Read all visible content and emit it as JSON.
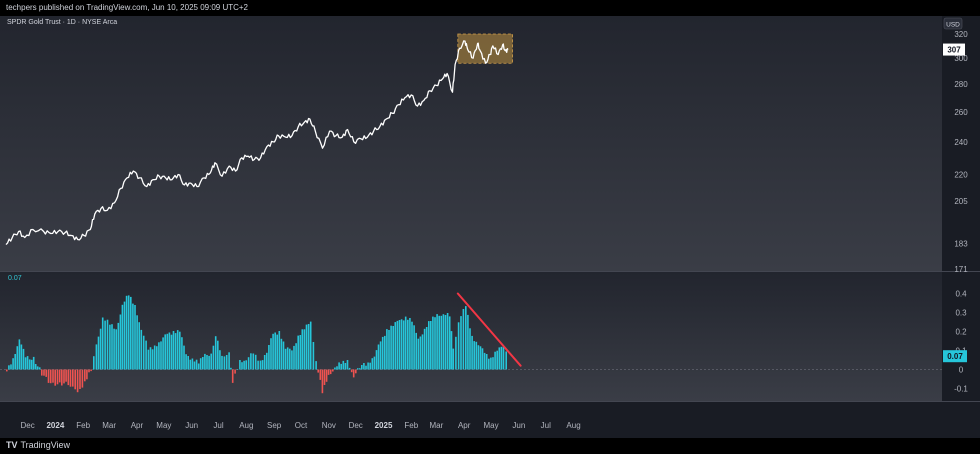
{
  "header": {
    "published": "techpers published on TradingView.com, Jun 10, 2025 09:09 UTC+2"
  },
  "symbol": {
    "name": "SPDR Gold Trust · 1D · NYSE Arca"
  },
  "price_scale": {
    "currency": "USD",
    "last_price": "307"
  },
  "indicator": {
    "label_value": "0.07",
    "last_value": "0.07"
  },
  "footer": {
    "brand": "TradingView"
  },
  "colors": {
    "background": "#191c24",
    "price_line": "#ffffff",
    "hist_positive": "#26c6da",
    "hist_negative": "#ef5350",
    "highlight_box": "#8a6d3b",
    "trend_line": "#f23645"
  },
  "chart_data": [
    {
      "type": "line",
      "title": "SPDR Gold Trust · 1D · NYSE Arca",
      "ylabel": "USD",
      "log_scale": true,
      "ylim": [
        171,
        320
      ],
      "yticks": [
        171,
        183,
        205,
        220,
        240,
        260,
        280,
        300,
        320
      ],
      "ytick_labels": [
        "171",
        "183",
        "205",
        "220",
        "240",
        "260",
        "280",
        "300",
        "320"
      ],
      "x_months": [
        "Dec",
        "2024",
        "Feb",
        "Mar",
        "Apr",
        "May",
        "Jun",
        "Jul",
        "Aug",
        "Sep",
        "Oct",
        "Nov",
        "Dec",
        "2025",
        "Feb",
        "Mar",
        "Apr",
        "May",
        "Jun",
        "Jul",
        "Aug"
      ],
      "x_month_bold": [
        "2024",
        "2025"
      ],
      "series": [
        {
          "points": [
            [
              "2023-11-27",
              182.5
            ],
            [
              "2023-12-04",
              186.0
            ],
            [
              "2023-12-11",
              189.0
            ],
            [
              "2023-12-18",
              186.0
            ],
            [
              "2023-12-27",
              190.0
            ],
            [
              "2024-01-08",
              189.0
            ],
            [
              "2024-01-16",
              188.0
            ],
            [
              "2024-01-24",
              189.0
            ],
            [
              "2024-02-01",
              188.5
            ],
            [
              "2024-02-08",
              187.0
            ],
            [
              "2024-02-15",
              185.0
            ],
            [
              "2024-02-22",
              187.0
            ],
            [
              "2024-02-29",
              190.0
            ],
            [
              "2024-03-05",
              198.0
            ],
            [
              "2024-03-12",
              201.0
            ],
            [
              "2024-03-19",
              200.0
            ],
            [
              "2024-03-27",
              204.0
            ],
            [
              "2024-04-03",
              212.0
            ],
            [
              "2024-04-10",
              218.0
            ],
            [
              "2024-04-17",
              222.0
            ],
            [
              "2024-04-24",
              218.0
            ],
            [
              "2024-05-02",
              213.0
            ],
            [
              "2024-05-09",
              217.0
            ],
            [
              "2024-05-16",
              219.0
            ],
            [
              "2024-05-23",
              218.0
            ],
            [
              "2024-05-30",
              217.0
            ],
            [
              "2024-06-06",
              220.0
            ],
            [
              "2024-06-13",
              214.0
            ],
            [
              "2024-06-20",
              215.0
            ],
            [
              "2024-06-27",
              213.0
            ],
            [
              "2024-07-05",
              218.0
            ],
            [
              "2024-07-12",
              221.0
            ],
            [
              "2024-07-17",
              227.0
            ],
            [
              "2024-07-25",
              219.0
            ],
            [
              "2024-08-02",
              225.0
            ],
            [
              "2024-08-09",
              222.0
            ],
            [
              "2024-08-16",
              230.0
            ],
            [
              "2024-08-23",
              231.0
            ],
            [
              "2024-08-30",
              229.0
            ],
            [
              "2024-09-06",
              230.0
            ],
            [
              "2024-09-13",
              237.0
            ],
            [
              "2024-09-20",
              240.0
            ],
            [
              "2024-09-26",
              244.0
            ],
            [
              "2024-10-04",
              243.0
            ],
            [
              "2024-10-11",
              244.0
            ],
            [
              "2024-10-18",
              250.0
            ],
            [
              "2024-10-25",
              253.0
            ],
            [
              "2024-10-31",
              255.0
            ],
            [
              "2024-11-06",
              247.0
            ],
            [
              "2024-11-14",
              236.0
            ],
            [
              "2024-11-22",
              247.0
            ],
            [
              "2024-11-29",
              244.0
            ],
            [
              "2024-12-06",
              243.0
            ],
            [
              "2024-12-12",
              248.0
            ],
            [
              "2024-12-19",
              240.0
            ],
            [
              "2024-12-27",
              242.0
            ],
            [
              "2025-01-03",
              243.0
            ],
            [
              "2025-01-10",
              247.0
            ],
            [
              "2025-01-17",
              250.0
            ],
            [
              "2025-01-24",
              255.0
            ],
            [
              "2025-01-31",
              259.0
            ],
            [
              "2025-02-07",
              265.0
            ],
            [
              "2025-02-14",
              270.0
            ],
            [
              "2025-02-21",
              272.0
            ],
            [
              "2025-02-28",
              264.0
            ],
            [
              "2025-03-07",
              268.0
            ],
            [
              "2025-03-14",
              275.0
            ],
            [
              "2025-03-21",
              279.0
            ],
            [
              "2025-03-28",
              284.0
            ],
            [
              "2025-04-02",
              288.0
            ],
            [
              "2025-04-08",
              274.0
            ],
            [
              "2025-04-11",
              295.0
            ],
            [
              "2025-04-16",
              308.0
            ],
            [
              "2025-04-22",
              314.0
            ],
            [
              "2025-04-25",
              307.0
            ],
            [
              "2025-05-01",
              300.0
            ],
            [
              "2025-05-06",
              312.0
            ],
            [
              "2025-05-09",
              306.0
            ],
            [
              "2025-05-15",
              296.0
            ],
            [
              "2025-05-20",
              303.0
            ],
            [
              "2025-05-23",
              310.0
            ],
            [
              "2025-05-29",
              303.0
            ],
            [
              "2025-06-03",
              311.0
            ],
            [
              "2025-06-06",
              306.0
            ],
            [
              "2025-06-09",
              307.0
            ]
          ]
        }
      ],
      "annotations": [
        {
          "type": "rectangle",
          "x": [
            "2025-04-14",
            "2025-06-14"
          ],
          "y": [
            296,
            320
          ]
        }
      ]
    },
    {
      "type": "bar",
      "ylim": [
        -0.15,
        0.45
      ],
      "yticks": [
        -0.1,
        0,
        0.1,
        0.2,
        0.3,
        0.4
      ],
      "ytick_labels": [
        "-0.1",
        "0",
        "0.1",
        "0.2",
        "0.3",
        "0.4"
      ],
      "series": [
        {
          "points": [
            [
              "2023-11-27",
              -0.01
            ],
            [
              "2023-12-04",
              0.05
            ],
            [
              "2023-12-11",
              0.17
            ],
            [
              "2023-12-18",
              0.06
            ],
            [
              "2023-12-27",
              0.06
            ],
            [
              "2024-01-05",
              -0.02
            ],
            [
              "2024-01-15",
              -0.08
            ],
            [
              "2024-01-25",
              -0.07
            ],
            [
              "2024-02-06",
              -0.08
            ],
            [
              "2024-02-14",
              -0.13
            ],
            [
              "2024-02-22",
              -0.06
            ],
            [
              "2024-02-29",
              0.0
            ],
            [
              "2024-03-06",
              0.12
            ],
            [
              "2024-03-13",
              0.28
            ],
            [
              "2024-03-21",
              0.24
            ],
            [
              "2024-03-28",
              0.2
            ],
            [
              "2024-04-04",
              0.35
            ],
            [
              "2024-04-11",
              0.39
            ],
            [
              "2024-04-18",
              0.33
            ],
            [
              "2024-04-25",
              0.22
            ],
            [
              "2024-05-03",
              0.1
            ],
            [
              "2024-05-10",
              0.12
            ],
            [
              "2024-05-17",
              0.16
            ],
            [
              "2024-05-24",
              0.18
            ],
            [
              "2024-05-31",
              0.2
            ],
            [
              "2024-06-07",
              0.21
            ],
            [
              "2024-06-14",
              0.07
            ],
            [
              "2024-06-21",
              0.06
            ],
            [
              "2024-06-28",
              0.04
            ],
            [
              "2024-07-05",
              0.07
            ],
            [
              "2024-07-12",
              0.09
            ],
            [
              "2024-07-17",
              0.18
            ],
            [
              "2024-07-24",
              0.06
            ],
            [
              "2024-08-01",
              0.1
            ],
            [
              "2024-08-05",
              -0.07
            ],
            [
              "2024-08-13",
              0.04
            ],
            [
              "2024-08-20",
              0.06
            ],
            [
              "2024-08-28",
              0.08
            ],
            [
              "2024-09-05",
              0.04
            ],
            [
              "2024-09-12",
              0.1
            ],
            [
              "2024-09-19",
              0.18
            ],
            [
              "2024-09-26",
              0.2
            ],
            [
              "2024-10-03",
              0.12
            ],
            [
              "2024-10-10",
              0.09
            ],
            [
              "2024-10-17",
              0.18
            ],
            [
              "2024-10-24",
              0.22
            ],
            [
              "2024-10-31",
              0.24
            ],
            [
              "2024-11-06",
              0.05
            ],
            [
              "2024-11-13",
              -0.12
            ],
            [
              "2024-11-20",
              -0.04
            ],
            [
              "2024-11-27",
              0.02
            ],
            [
              "2024-12-04",
              0.03
            ],
            [
              "2024-12-11",
              0.04
            ],
            [
              "2024-12-18",
              -0.03
            ],
            [
              "2024-12-27",
              0.02
            ],
            [
              "2025-01-03",
              0.03
            ],
            [
              "2025-01-10",
              0.08
            ],
            [
              "2025-01-17",
              0.14
            ],
            [
              "2025-01-24",
              0.21
            ],
            [
              "2025-01-31",
              0.24
            ],
            [
              "2025-02-07",
              0.25
            ],
            [
              "2025-02-14",
              0.28
            ],
            [
              "2025-02-21",
              0.26
            ],
            [
              "2025-02-28",
              0.15
            ],
            [
              "2025-03-07",
              0.22
            ],
            [
              "2025-03-14",
              0.26
            ],
            [
              "2025-03-21",
              0.28
            ],
            [
              "2025-03-28",
              0.3
            ],
            [
              "2025-04-04",
              0.28
            ],
            [
              "2025-04-08",
              0.1
            ],
            [
              "2025-04-14",
              0.26
            ],
            [
              "2025-04-22",
              0.33
            ],
            [
              "2025-04-29",
              0.17
            ],
            [
              "2025-05-06",
              0.14
            ],
            [
              "2025-05-13",
              0.08
            ],
            [
              "2025-05-20",
              0.06
            ],
            [
              "2025-05-27",
              0.11
            ],
            [
              "2025-06-03",
              0.11
            ],
            [
              "2025-06-09",
              0.07
            ]
          ]
        }
      ],
      "annotations": [
        {
          "type": "trendline",
          "x": [
            "2025-04-14",
            "2025-06-23"
          ],
          "y": [
            0.4,
            0.02
          ]
        }
      ]
    }
  ]
}
